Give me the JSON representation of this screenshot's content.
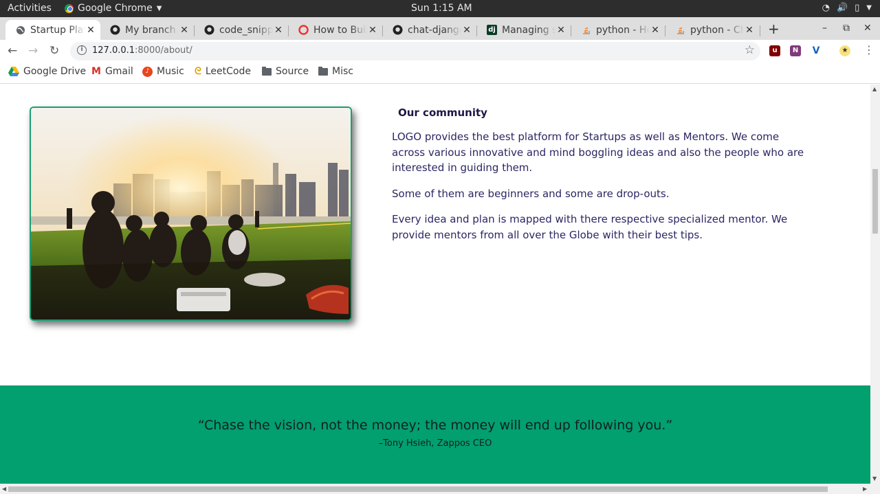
{
  "system_bar": {
    "activities": "Activities",
    "app_name": "Google Chrome",
    "clock": "Sun  1:15 AM"
  },
  "tabs": [
    {
      "title": "Startup Platform",
      "icon": "globe-icon",
      "active": true
    },
    {
      "title": "My branch by",
      "icon": "github-icon"
    },
    {
      "title": "code_snippets",
      "icon": "github-icon"
    },
    {
      "title": "How to Build",
      "icon": "lifebuoy-icon"
    },
    {
      "title": "chat-django",
      "icon": "github-icon"
    },
    {
      "title": "Managing static",
      "icon": "django-icon"
    },
    {
      "title": "python - How",
      "icon": "stackoverflow-icon"
    },
    {
      "title": "python - Change",
      "icon": "stackoverflow-icon"
    }
  ],
  "address": {
    "host": "127.0.0.1",
    "path": ":8000/about/"
  },
  "bookmarks": [
    {
      "label": "Google Drive",
      "icon": "google-drive-icon"
    },
    {
      "label": "Gmail",
      "icon": "gmail-icon"
    },
    {
      "label": "Music",
      "icon": "music-icon"
    },
    {
      "label": "LeetCode",
      "icon": "leetcode-icon"
    },
    {
      "label": "Source",
      "icon": "folder-icon"
    },
    {
      "label": "Misc",
      "icon": "folder-icon"
    }
  ],
  "about": {
    "heading": "Our community",
    "paragraphs": [
      "LOGO provides the best platform for Startups as well as Mentors. We come across various innovative and mind boggling ideas and also the people who are interested in guiding them.",
      "Some of them are beginners and some are drop-outs.",
      "Every idea and plan is mapped with there respective specialized mentor. We provide mentors from all over the Globe with their best tips."
    ]
  },
  "quote": {
    "text": "“Chase the vision, not the money; the money will end up following you.”",
    "author": "–Tony Hsieh, Zappos CEO"
  },
  "colors": {
    "accent_green": "#029f6f",
    "text_indigo": "#2b2663"
  }
}
